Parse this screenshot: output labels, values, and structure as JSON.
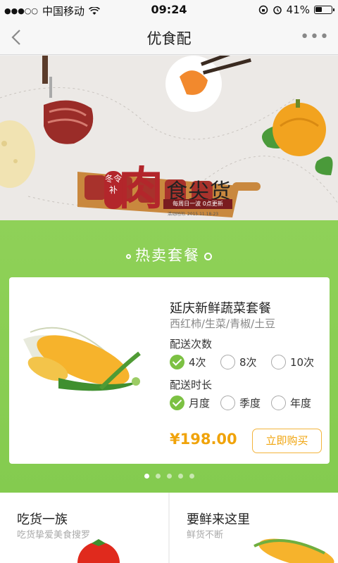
{
  "status_bar": {
    "carrier": "中国移动",
    "signal_dots": "●●●○○",
    "time": "09:24",
    "battery": "41%"
  },
  "nav": {
    "title": "优食配",
    "more": "•••"
  },
  "banner": {
    "headline_big": "肉",
    "headline_rest": "食尖货",
    "badge": "冬令补",
    "strip": "每周日一波 0点更新",
    "date": "活动时间: 2015.11.18-23"
  },
  "hot": {
    "title": "热卖套餐",
    "product": {
      "name": "延庆新鲜蔬菜套餐",
      "desc": "西红柿/生菜/青椒/土豆",
      "freq_label": "配送次数",
      "freq_options": [
        {
          "label": "4次",
          "checked": true
        },
        {
          "label": "8次",
          "checked": false
        },
        {
          "label": "10次",
          "checked": false
        }
      ],
      "duration_label": "配送时长",
      "duration_options": [
        {
          "label": "月度",
          "checked": true
        },
        {
          "label": "季度",
          "checked": false
        },
        {
          "label": "年度",
          "checked": false
        }
      ],
      "price": "¥198.00",
      "buy_label": "立即购买"
    },
    "pager": {
      "total": 5,
      "active": 1
    }
  },
  "tiles": [
    {
      "title": "吃货一族",
      "subtitle": "吃货挚爱美食搜罗"
    },
    {
      "title": "要鲜来这里",
      "subtitle": "鲜货不断"
    }
  ],
  "colors": {
    "green": "#8fd158",
    "check": "#7cc143",
    "price": "#f0a30a",
    "meat_red": "#b3262b"
  }
}
